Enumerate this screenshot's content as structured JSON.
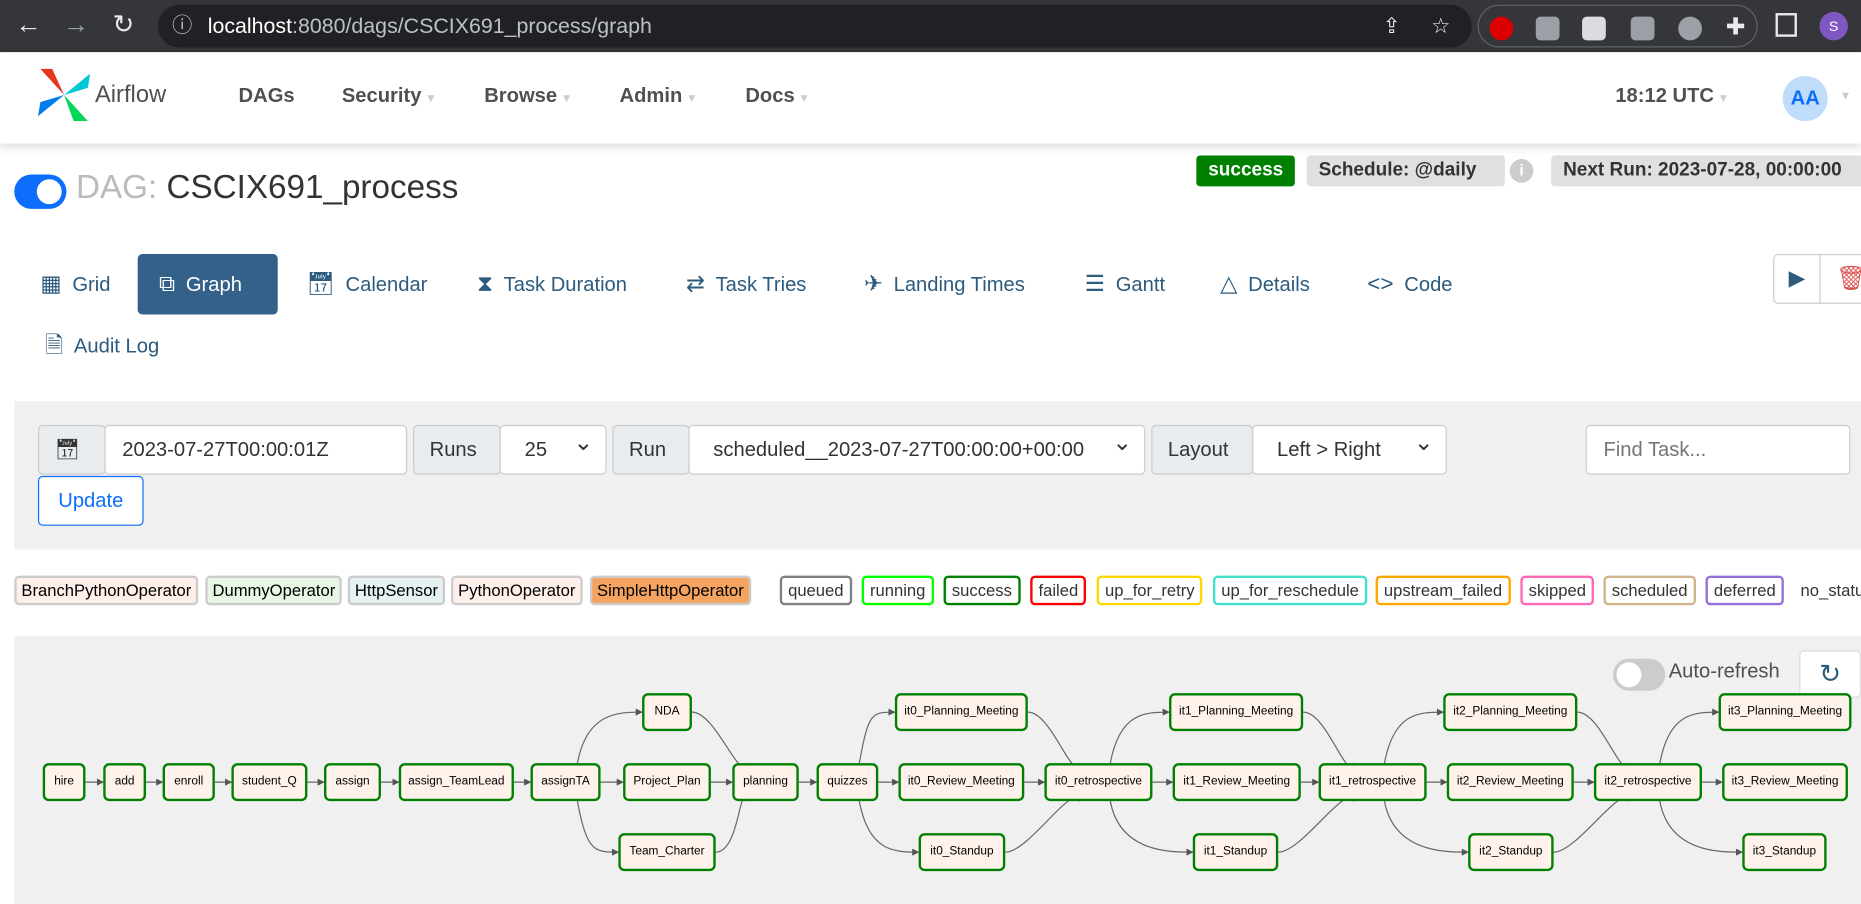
{
  "browser": {
    "url_host": "localhost",
    "url_path": ":8080/dags/CSCIX691_process/graph",
    "profile": "S"
  },
  "navbar": {
    "brand": "Airflow",
    "items": [
      "DAGs",
      "Security",
      "Browse",
      "Admin",
      "Docs"
    ],
    "time": "18:12 UTC",
    "user": "AA"
  },
  "dag": {
    "prefix": "DAG:",
    "name": "CSCIX691_process",
    "status": "success",
    "schedule": "Schedule: @daily",
    "next_run": "Next Run: 2023-07-28, 00:00:00"
  },
  "tabs": [
    "Grid",
    "Graph",
    "Calendar",
    "Task Duration",
    "Task Tries",
    "Landing Times",
    "Gantt",
    "Details",
    "Code",
    "Audit Log"
  ],
  "active_tab": "Graph",
  "controls": {
    "date": "2023-07-27T00:00:01Z",
    "runs_label": "Runs",
    "runs_value": "25",
    "run_label": "Run",
    "run_value": "scheduled__2023-07-27T00:00:00+00:00",
    "layout_label": "Layout",
    "layout_value": "Left > Right",
    "find_placeholder": "Find Task...",
    "update": "Update"
  },
  "operators": [
    {
      "name": "BranchPythonOperator",
      "color": "#ffefeb"
    },
    {
      "name": "DummyOperator",
      "color": "#e8f7e4"
    },
    {
      "name": "HttpSensor",
      "color": "#e6f1f2"
    },
    {
      "name": "PythonOperator",
      "color": "#ffefeb"
    },
    {
      "name": "SimpleHttpOperator",
      "color": "#f4a460"
    }
  ],
  "states": [
    {
      "name": "queued",
      "color": "#808080"
    },
    {
      "name": "running",
      "color": "#00ff00"
    },
    {
      "name": "success",
      "color": "#008000"
    },
    {
      "name": "failed",
      "color": "#ff0000"
    },
    {
      "name": "up_for_retry",
      "color": "#ffd700"
    },
    {
      "name": "up_for_reschedule",
      "color": "#40e0d0"
    },
    {
      "name": "upstream_failed",
      "color": "#ffa500"
    },
    {
      "name": "skipped",
      "color": "#ff69b4"
    },
    {
      "name": "scheduled",
      "color": "#d2b48c"
    },
    {
      "name": "deferred",
      "color": "#9370db"
    },
    {
      "name": "no_status",
      "color": "#ffffff"
    }
  ],
  "graph": {
    "auto_refresh": "Auto-refresh",
    "tasks": [
      "hire",
      "add",
      "enroll",
      "student_Q",
      "assign",
      "assign_TeamLead",
      "assignTA",
      "NDA",
      "Project_Plan",
      "Team_Charter",
      "planning",
      "quizzes",
      "it0_Planning_Meeting",
      "it0_Review_Meeting",
      "it0_Standup",
      "it0_retrospective",
      "it1_Planning_Meeting",
      "it1_Review_Meeting",
      "it1_Standup",
      "it1_retrospective",
      "it2_Planning_Meeting",
      "it2_Review_Meeting",
      "it2_Standup",
      "it2_retrospective",
      "it3_Planning_Meeting",
      "it3_Review_Meeting",
      "it3_Standup"
    ],
    "edges": [
      [
        "hire",
        "add"
      ],
      [
        "add",
        "enroll"
      ],
      [
        "enroll",
        "student_Q"
      ],
      [
        "student_Q",
        "assign"
      ],
      [
        "assign",
        "assign_TeamLead"
      ],
      [
        "assign_TeamLead",
        "assignTA"
      ],
      [
        "assignTA",
        "NDA"
      ],
      [
        "assignTA",
        "Project_Plan"
      ],
      [
        "assignTA",
        "Team_Charter"
      ],
      [
        "NDA",
        "planning"
      ],
      [
        "Project_Plan",
        "planning"
      ],
      [
        "Team_Charter",
        "planning"
      ],
      [
        "planning",
        "quizzes"
      ],
      [
        "quizzes",
        "it0_Planning_Meeting"
      ],
      [
        "quizzes",
        "it0_Review_Meeting"
      ],
      [
        "quizzes",
        "it0_Standup"
      ],
      [
        "it0_Planning_Meeting",
        "it0_retrospective"
      ],
      [
        "it0_Review_Meeting",
        "it0_retrospective"
      ],
      [
        "it0_Standup",
        "it0_retrospective"
      ],
      [
        "it0_retrospective",
        "it1_Planning_Meeting"
      ],
      [
        "it0_retrospective",
        "it1_Review_Meeting"
      ],
      [
        "it0_retrospective",
        "it1_Standup"
      ],
      [
        "it1_Planning_Meeting",
        "it1_retrospective"
      ],
      [
        "it1_Review_Meeting",
        "it1_retrospective"
      ],
      [
        "it1_Standup",
        "it1_retrospective"
      ],
      [
        "it1_retrospective",
        "it2_Planning_Meeting"
      ],
      [
        "it1_retrospective",
        "it2_Review_Meeting"
      ],
      [
        "it1_retrospective",
        "it2_Standup"
      ],
      [
        "it2_Planning_Meeting",
        "it2_retrospective"
      ],
      [
        "it2_Review_Meeting",
        "it2_retrospective"
      ],
      [
        "it2_Standup",
        "it2_retrospective"
      ],
      [
        "it2_retrospective",
        "it3_Planning_Meeting"
      ],
      [
        "it2_retrospective",
        "it3_Review_Meeting"
      ],
      [
        "it2_retrospective",
        "it3_Standup"
      ]
    ],
    "task_state": "success"
  }
}
